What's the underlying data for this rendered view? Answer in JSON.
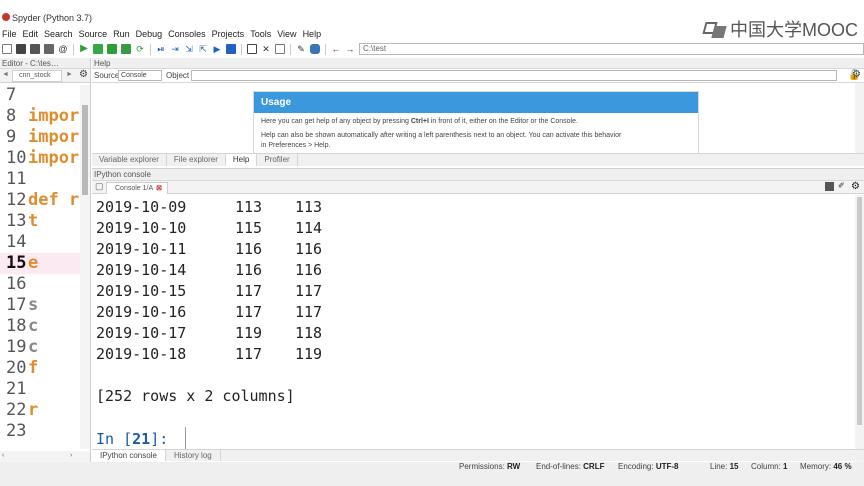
{
  "window": {
    "title": "Spyder (Python 3.7)"
  },
  "watermark": {
    "text": "中国大学MOOC"
  },
  "menu": [
    "File",
    "Edit",
    "Search",
    "Source",
    "Run",
    "Debug",
    "Consoles",
    "Projects",
    "Tools",
    "View",
    "Help"
  ],
  "toolbar": {
    "path": "C:\\test"
  },
  "editor": {
    "header": "Editor - C:\\tes…",
    "tab": "cnn_stock",
    "lines": [
      {
        "num": "7",
        "code": ""
      },
      {
        "num": "8",
        "code": "impor"
      },
      {
        "num": "9",
        "code": "impor"
      },
      {
        "num": "10",
        "code": "impor"
      },
      {
        "num": "11",
        "code": ""
      },
      {
        "num": "12",
        "code": "def r"
      },
      {
        "num": "13",
        "code": "    t"
      },
      {
        "num": "14",
        "code": ""
      },
      {
        "num": "15",
        "code": "    e"
      },
      {
        "num": "16",
        "code": ""
      },
      {
        "num": "17",
        "code": "    s"
      },
      {
        "num": "18",
        "code": "    c"
      },
      {
        "num": "19",
        "code": "    c"
      },
      {
        "num": "20",
        "code": "    f"
      },
      {
        "num": "21",
        "code": ""
      },
      {
        "num": "22",
        "code": "    r"
      },
      {
        "num": "23",
        "code": ""
      }
    ],
    "current_line": "15"
  },
  "help": {
    "header": "Help",
    "source_label": "Source",
    "source_value": "Console",
    "object_label": "Object",
    "usage_title": "Usage",
    "usage_text_before": "Here you can get help of any object by pressing ",
    "usage_shortcut": "Ctrl+I",
    "usage_text_after": " in front of it, either on the Editor or the Console.",
    "usage_text_2": "Help can also be shown automatically after writing a left parenthesis next to an object. You can activate this behavior",
    "usage_text_3": "in Preferences > Help."
  },
  "top_tabs": [
    "Variable explorer",
    "File explorer",
    "Help",
    "Profiler"
  ],
  "top_tabs_active": "Help",
  "console": {
    "header": "IPython console",
    "tab": "Console 1/A",
    "rows": [
      {
        "date": "2019-10-09",
        "a": "113",
        "b": "113"
      },
      {
        "date": "2019-10-10",
        "a": "115",
        "b": "114"
      },
      {
        "date": "2019-10-11",
        "a": "116",
        "b": "116"
      },
      {
        "date": "2019-10-14",
        "a": "116",
        "b": "116"
      },
      {
        "date": "2019-10-15",
        "a": "117",
        "b": "117"
      },
      {
        "date": "2019-10-16",
        "a": "117",
        "b": "117"
      },
      {
        "date": "2019-10-17",
        "a": "119",
        "b": "118"
      },
      {
        "date": "2019-10-18",
        "a": "117",
        "b": "119"
      }
    ],
    "summary": "[252 rows x 2 columns]",
    "prompt_in": "In [",
    "prompt_num": "21",
    "prompt_end": "]:"
  },
  "bottom_tabs": [
    "IPython console",
    "History log"
  ],
  "bottom_tabs_active": "IPython console",
  "status": {
    "permissions_label": "Permissions:",
    "permissions": "RW",
    "eol_label": "End-of-lines:",
    "eol": "CRLF",
    "encoding_label": "Encoding:",
    "encoding": "UTF-8",
    "line_label": "Line:",
    "line": "15",
    "column_label": "Column:",
    "column": "1",
    "memory_label": "Memory:",
    "memory": "46 %"
  }
}
